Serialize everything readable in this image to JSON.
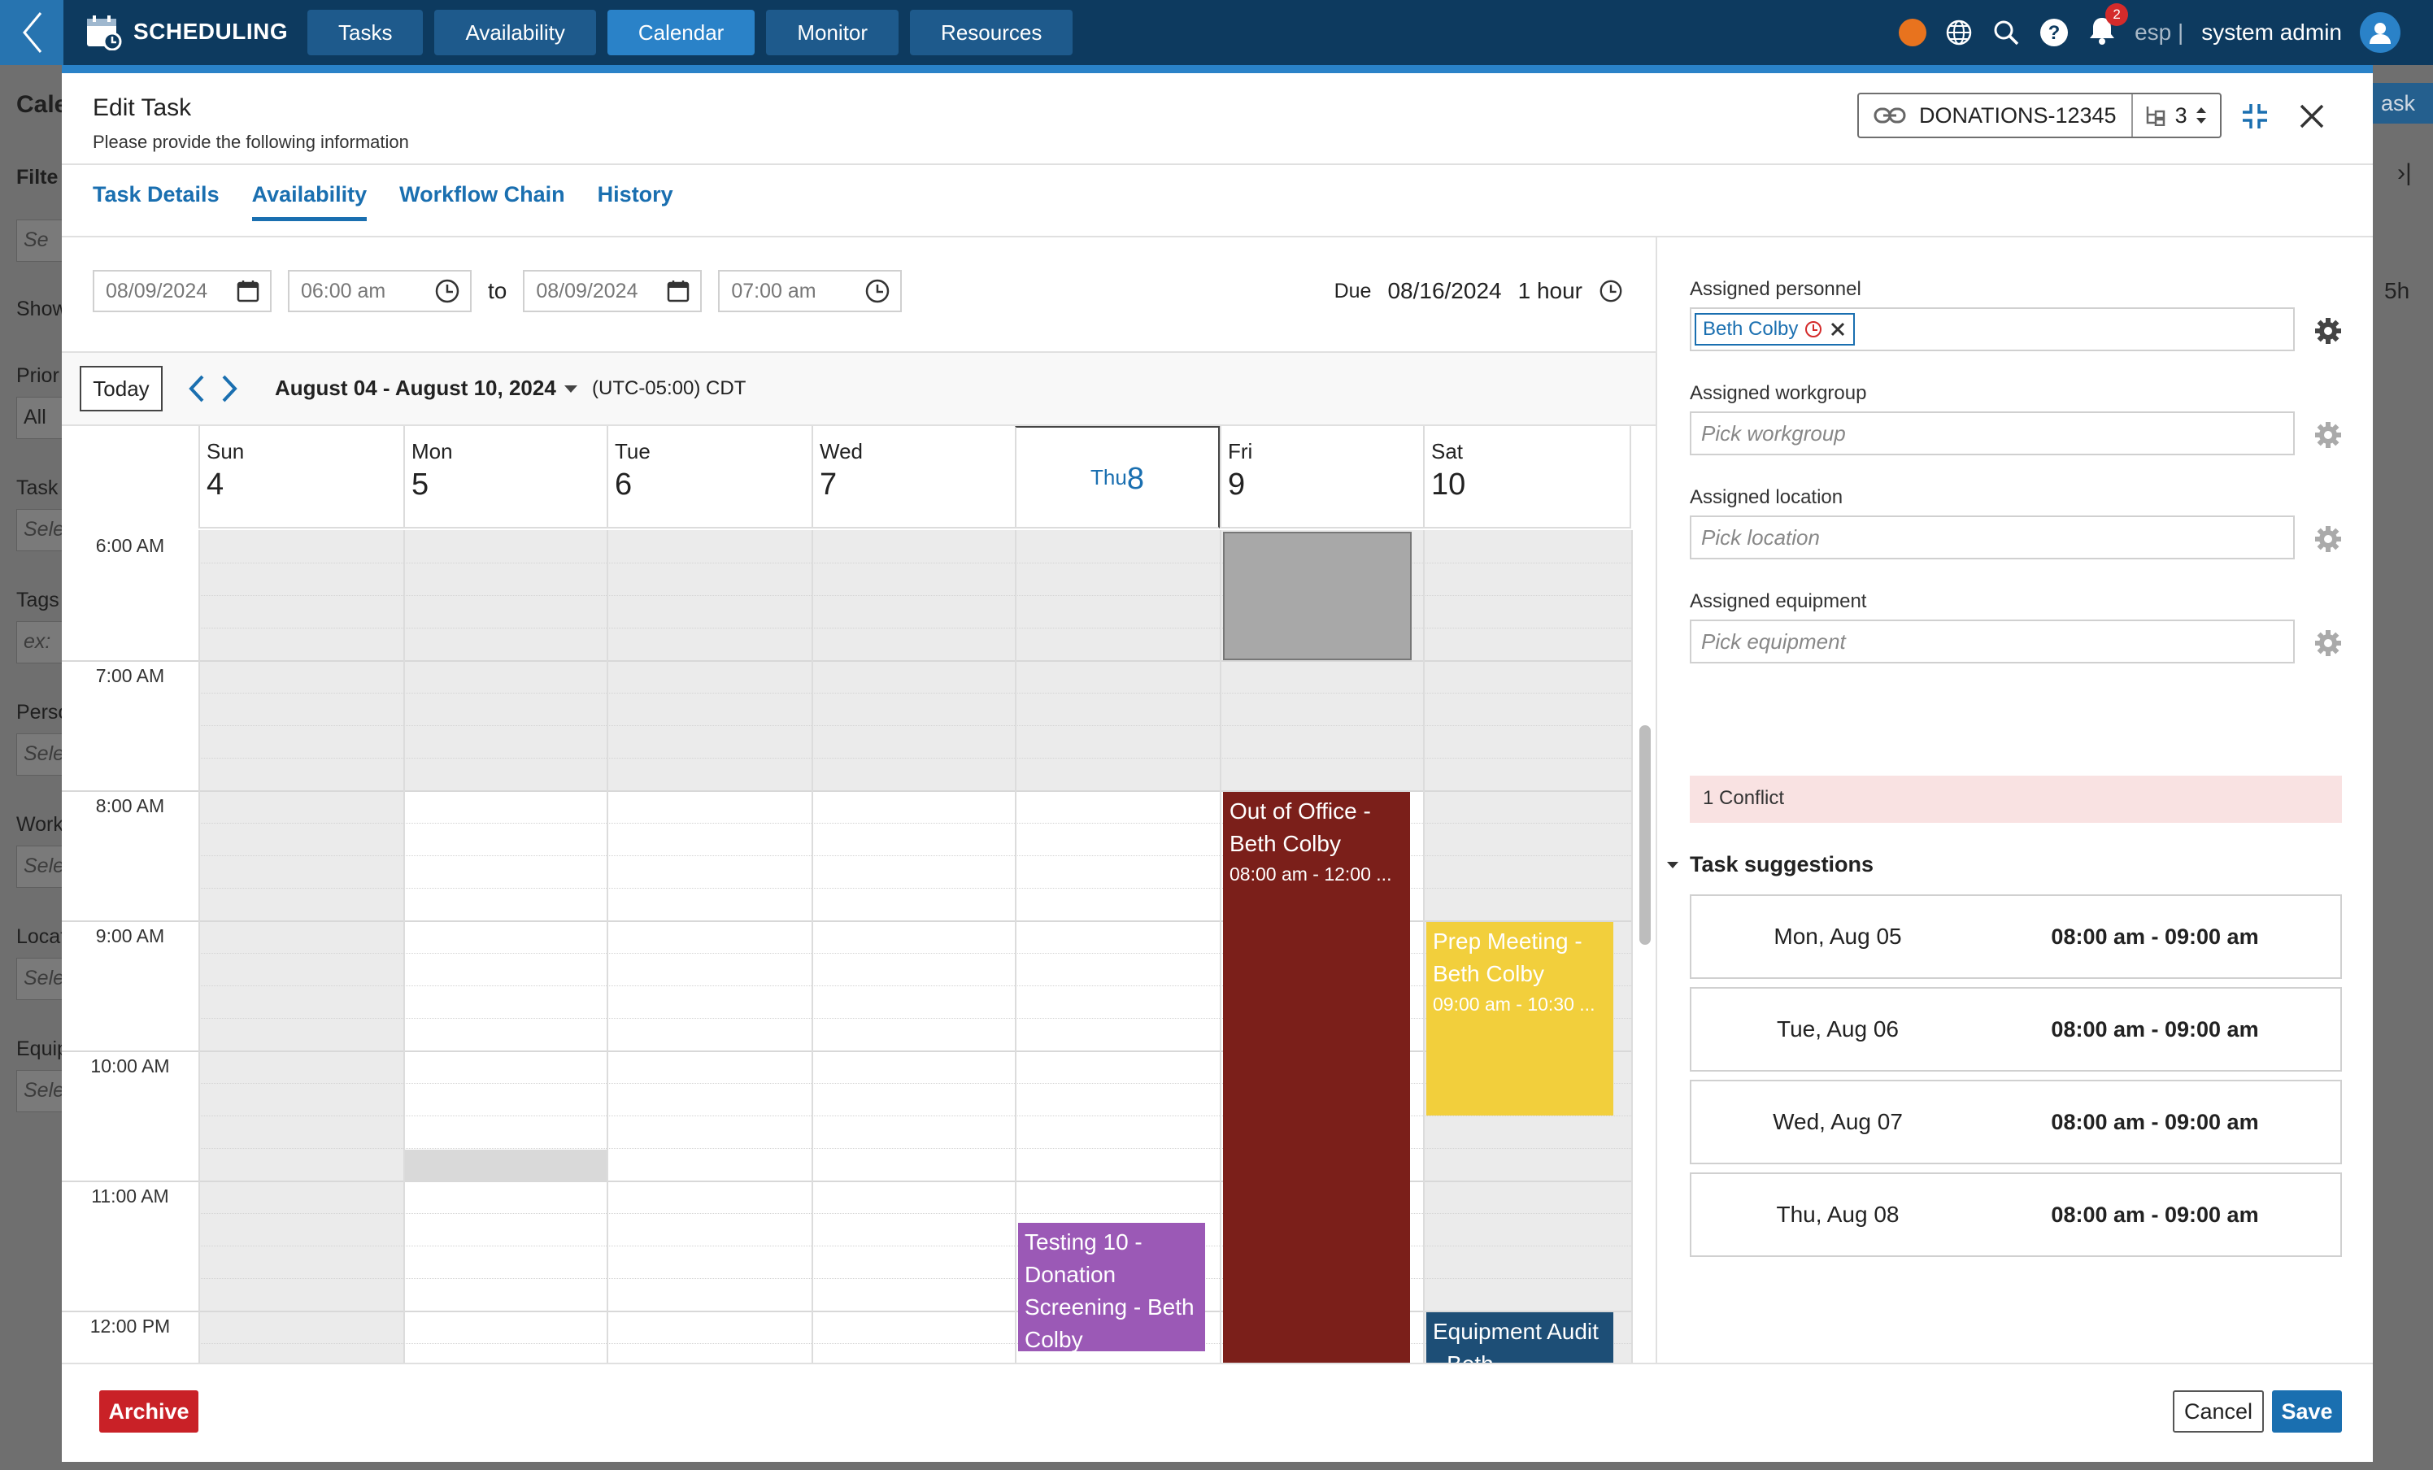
{
  "app": {
    "brand": "SCHEDULING"
  },
  "nav": {
    "tabs": [
      "Tasks",
      "Availability",
      "Calendar",
      "Monitor",
      "Resources"
    ],
    "active": "Calendar"
  },
  "topright": {
    "notif_count": "2",
    "lang": "esp |",
    "user": "system admin"
  },
  "background": {
    "cal_label": "Cale",
    "filter_label": "Filte",
    "search_placeholder": "Se",
    "show_label": "Show",
    "prio_label": "Prior",
    "prio_value": "All",
    "task_label": "Task",
    "task_placeholder": "Sele",
    "tags_label": "Tags",
    "tags_placeholder": "ex:",
    "pers_label": "Perso",
    "pers_placeholder": "Sele",
    "work_label": "Work",
    "work_placeholder": "Sele",
    "loc_label": "Locat",
    "loc_placeholder": "Sele",
    "equip_label": "Equip",
    "equip_placeholder": "Sele",
    "new_task_btn": "ask",
    "hours_label": "5h"
  },
  "modal": {
    "title": "Edit Task",
    "subtitle": "Please provide the following information",
    "task_id": "DONATIONS-12345",
    "chain_count": "3",
    "tabs": [
      "Task Details",
      "Availability",
      "Workflow Chain",
      "History"
    ],
    "active_tab": "Availability"
  },
  "datetime": {
    "start_date": "08/09/2024",
    "start_time": "06:00 am",
    "to_label": "to",
    "end_date": "08/09/2024",
    "end_time": "07:00 am",
    "due_label": "Due",
    "due_date": "08/16/2024",
    "duration": "1 hour"
  },
  "calendar": {
    "today_btn": "Today",
    "range": "August 04 - August 10, 2024",
    "timezone": "(UTC-05:00) CDT",
    "days": [
      {
        "name": "Sun",
        "num": "4"
      },
      {
        "name": "Mon",
        "num": "5"
      },
      {
        "name": "Tue",
        "num": "6"
      },
      {
        "name": "Wed",
        "num": "7"
      },
      {
        "name": "Thu",
        "num": "8"
      },
      {
        "name": "Fri",
        "num": "9"
      },
      {
        "name": "Sat",
        "num": "10"
      }
    ],
    "today_day": "Thu",
    "times": [
      "6:00 AM",
      "7:00 AM",
      "8:00 AM",
      "9:00 AM",
      "10:00 AM",
      "11:00 AM",
      "12:00 PM"
    ],
    "events": [
      {
        "title": "Out of Office - Beth Colby",
        "time": "08:00 am - 12:00 ...",
        "color": "#7b1f1a"
      },
      {
        "title": "Prep Meeting - Beth Colby",
        "time": "09:00 am - 10:30 ...",
        "color": "#f2cf3c"
      },
      {
        "title": "Testing 10 - Donation Screening - Beth Colby",
        "color": "#9b59b6"
      },
      {
        "title": "Equipment Audit - Beth",
        "color": "#1d4e76"
      }
    ]
  },
  "assign": {
    "personnel_label": "Assigned personnel",
    "personnel_chip": "Beth Colby",
    "workgroup_label": "Assigned workgroup",
    "workgroup_placeholder": "Pick workgroup",
    "location_label": "Assigned location",
    "location_placeholder": "Pick location",
    "equipment_label": "Assigned equipment",
    "equipment_placeholder": "Pick equipment"
  },
  "conflict": "1 Conflict",
  "suggestions": {
    "title": "Task suggestions",
    "items": [
      {
        "date": "Mon, Aug 05",
        "time": "08:00 am - 09:00 am"
      },
      {
        "date": "Tue, Aug 06",
        "time": "08:00 am - 09:00 am"
      },
      {
        "date": "Wed, Aug 07",
        "time": "08:00 am - 09:00 am"
      },
      {
        "date": "Thu, Aug 08",
        "time": "08:00 am - 09:00 am"
      }
    ]
  },
  "footer": {
    "archive": "Archive",
    "cancel": "Cancel",
    "save": "Save"
  },
  "icons": [
    "back-chevron-icon",
    "calendar-brand-icon",
    "status-dot-icon",
    "globe-icon",
    "search-icon",
    "help-icon",
    "bell-icon",
    "user-icon",
    "link-icon",
    "hierarchy-icon",
    "sort-icon",
    "minimize-icon",
    "close-icon",
    "calendar-icon",
    "clock-icon",
    "chevron-left-icon",
    "chevron-right-icon",
    "caret-down-icon",
    "gear-icon",
    "remove-icon",
    "collapse-caret-icon"
  ]
}
